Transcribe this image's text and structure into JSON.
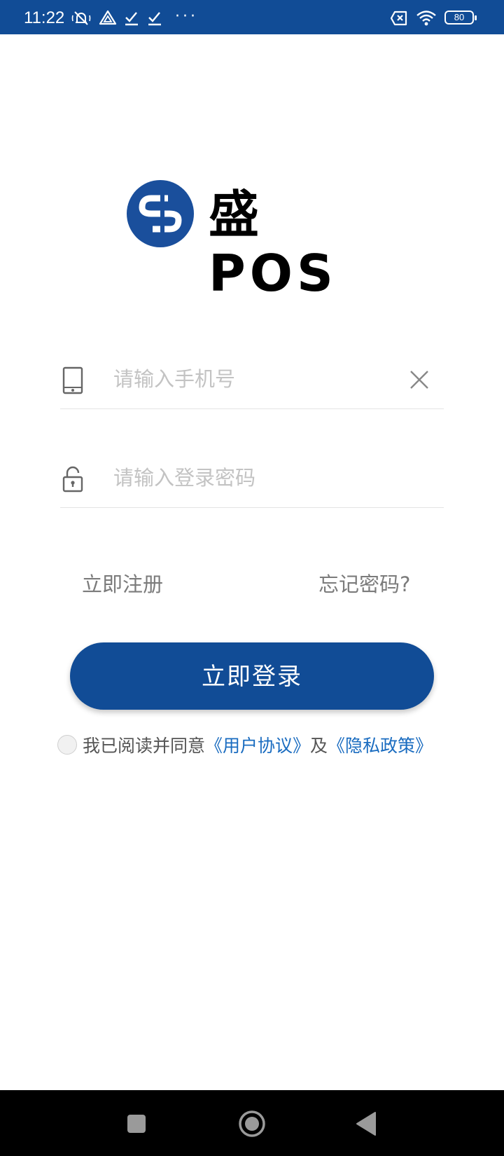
{
  "status_bar": {
    "time": "11:22",
    "icons": [
      "muted-bell-icon",
      "drive-icon",
      "check-icon",
      "check-icon",
      "more-dots-icon",
      "sim-off-icon",
      "wifi-icon",
      "battery-icon"
    ],
    "more": "···",
    "battery_level": "80"
  },
  "logo": {
    "text": "盛POS",
    "brand_color": "#1a4f9c"
  },
  "phone_field": {
    "placeholder": "请输入手机号",
    "value": "",
    "icon": "phone-icon",
    "clear_icon": "close-icon"
  },
  "password_field": {
    "placeholder": "请输入登录密码",
    "value": "",
    "icon": "unlock-icon"
  },
  "links": {
    "register": "立即注册",
    "forgot": "忘记密码?"
  },
  "login_button": {
    "label": "立即登录",
    "color": "#114c96"
  },
  "agreement": {
    "prefix": "我已阅读并同意",
    "user_agreement": "《用户协议》",
    "and": "及",
    "privacy_policy": "《隐私政策》",
    "checked": false,
    "link_color": "#1a6cc0"
  },
  "nav_bar": {
    "icons": [
      "recents-square-icon",
      "home-circle-icon",
      "back-triangle-icon"
    ]
  }
}
